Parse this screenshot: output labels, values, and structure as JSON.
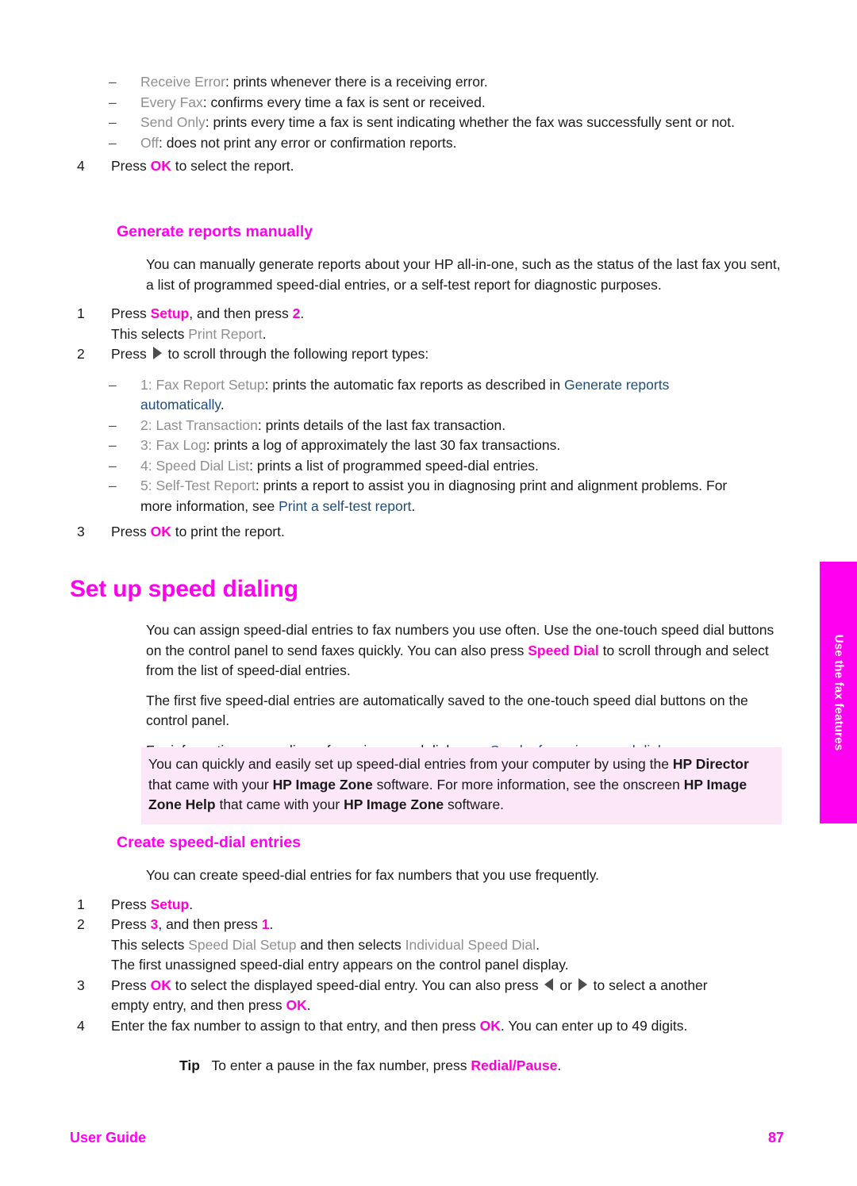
{
  "page": {
    "number": "87",
    "footer_label": "User Guide",
    "side_tab_label": "Use the fax features",
    "accent_magenta": "#ff00f0",
    "key_magenta": "#ff00d4",
    "ui_gray": "#8f8f8f",
    "link_blue": "#1f4d7a",
    "note_bg": "#fbe7f7"
  },
  "report_options": {
    "items": [
      {
        "dash": "–",
        "term": "Receive Error",
        "text": ": prints whenever there is a receiving error."
      },
      {
        "dash": "–",
        "term": "Every Fax",
        "text": ": confirms every time a fax is sent or received."
      },
      {
        "dash": "–",
        "term": "Send Only",
        "text": ": prints every time a fax is sent indicating whether the fax was successfully sent or not."
      },
      {
        "dash": "–",
        "term": "Off",
        "text": ": does not print any error or confirmation reports."
      }
    ],
    "step4": {
      "num": "4",
      "pre": "Press ",
      "key": "OK",
      "post": " to select the report."
    }
  },
  "generate_manually": {
    "heading": "Generate reports manually",
    "intro": "You can manually generate reports about your HP all-in-one, such as the status of the last fax you sent, a list of programmed speed-dial entries, or a self-test report for diagnostic purposes.",
    "step1": {
      "num": "1",
      "pre": "Press ",
      "key1": "Setup",
      "mid": ", and then press ",
      "key2": "2",
      "post": ".",
      "sub_pre": "This selects ",
      "sub_ui": "Print Report",
      "sub_post": "."
    },
    "step2": {
      "num": "2",
      "pre": "Press ",
      "arrow": "right-arrow",
      "post": " to scroll through the following report types:"
    },
    "types": [
      {
        "dash": "–",
        "term": "1: Fax Report Setup",
        "text": ": prints the automatic fax reports as described in ",
        "link": "Generate reports automatically",
        "tail": "."
      },
      {
        "dash": "–",
        "term": "2: Last Transaction",
        "text": ": prints details of the last fax transaction.",
        "link": "",
        "tail": ""
      },
      {
        "dash": "–",
        "term": "3: Fax Log",
        "text": ": prints a log of approximately the last 30 fax transactions.",
        "link": "",
        "tail": ""
      },
      {
        "dash": "–",
        "term": "4: Speed Dial List",
        "text": ": prints a list of programmed speed-dial entries.",
        "link": "",
        "tail": ""
      },
      {
        "dash": "–",
        "term": "5: Self-Test Report",
        "text": ": prints a report to assist you in diagnosing print and alignment problems. For more information, see ",
        "link": "Print a self-test report",
        "tail": "."
      }
    ],
    "step3": {
      "num": "3",
      "pre": "Press ",
      "key": "OK",
      "post": " to print the report."
    }
  },
  "speed_dialing": {
    "heading": "Set up speed dialing",
    "para1_pre": "You can assign speed-dial entries to fax numbers you use often. Use the one-touch speed dial buttons on the control panel to send faxes quickly. You can also press ",
    "para1_key": "Speed Dial",
    "para1_post": " to scroll through and select from the list of speed-dial entries.",
    "para2": "The first five speed-dial entries are automatically saved to the one-touch speed dial buttons on the control panel.",
    "para3_pre": "For information on sending a fax using speed dials, see ",
    "para3_link": "Send a fax using speed dials",
    "para3_post": ".",
    "note": {
      "s1": "You can quickly and easily set up speed-dial entries from your computer by using the ",
      "b1": "HP Director",
      "s2": " that came with your ",
      "b2": "HP Image Zone",
      "s3": " software. For more information, see the onscreen ",
      "b3": "HP Image Zone Help",
      "s4": " that came with your ",
      "b4": "HP Image Zone",
      "s5": " software."
    }
  },
  "create_entries": {
    "heading": "Create speed-dial entries",
    "intro": "You can create speed-dial entries for fax numbers that you use frequently.",
    "step1": {
      "num": "1",
      "pre": "Press ",
      "key": "Setup",
      "post": "."
    },
    "step2": {
      "num": "2",
      "pre": "Press ",
      "key1": "3",
      "mid": ", and then press ",
      "key2": "1",
      "post": ".",
      "sub1_pre": "This selects ",
      "sub1_ui1": "Speed Dial Setup",
      "sub1_mid": " and then selects ",
      "sub1_ui2": "Individual Speed Dial",
      "sub1_post": ".",
      "sub2": "The first unassigned speed-dial entry appears on the control panel display."
    },
    "step3": {
      "num": "3",
      "pre": "Press ",
      "key1": "OK",
      "mid1": " to select the displayed speed-dial entry. You can also press ",
      "arrow_left": "left-arrow",
      "mid2": " or ",
      "arrow_right": "right-arrow",
      "mid3": " to select a another empty entry, and then press ",
      "key2": "OK",
      "post": "."
    },
    "step4": {
      "num": "4",
      "pre": "Enter the fax number to assign to that entry, and then press ",
      "key": "OK",
      "post": ". You can enter up to 49 digits."
    },
    "tip": {
      "label": "Tip",
      "pre": "To enter a pause in the fax number, press ",
      "key": "Redial/Pause",
      "post": "."
    }
  }
}
